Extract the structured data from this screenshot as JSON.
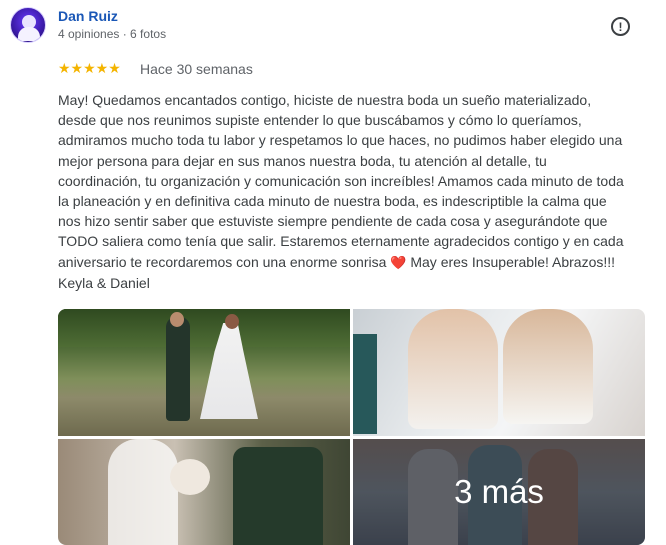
{
  "reviewer": {
    "name": "Dan Ruiz",
    "meta": "4 opiniones · 6 fotos",
    "avatar_icon": "profile-avatar-icon"
  },
  "review": {
    "rating": 5,
    "stars_text": "★★★★★",
    "time": "Hace 30 semanas",
    "text_before_heart": "May! Quedamos encantados contigo, hiciste de nuestra boda un sueño materializado,\ndesde que nos reunimos supiste entender lo que buscábamos y cómo lo queríamos,\nadmiramos mucho toda tu labor y respetamos lo que haces, no pudimos haber elegido una\nmejor persona para dejar en sus manos nuestra boda, tu atención al detalle, tu\ncoordinación, tu organización y comunicación son increíbles! Amamos cada minuto de toda\nla planeación y en definitiva cada minuto de nuestra boda, es indescriptible la calma que\nnos hizo sentir saber que estuviste siempre pendiente de cada cosa y asegurándote que\nTODO saliera como tenía que salir. Estaremos eternamente agradecidos contigo y en cada\naniversario te recordaremos con una enorme sonrisa ",
    "heart": "❤️",
    "text_after_heart": " May eres Insuperable! Abrazos!!!\nKeyla & Daniel"
  },
  "actions": {
    "report_icon": "report-flag-icon",
    "report_symbol": "!"
  },
  "photos": {
    "more_label": "3 más"
  }
}
